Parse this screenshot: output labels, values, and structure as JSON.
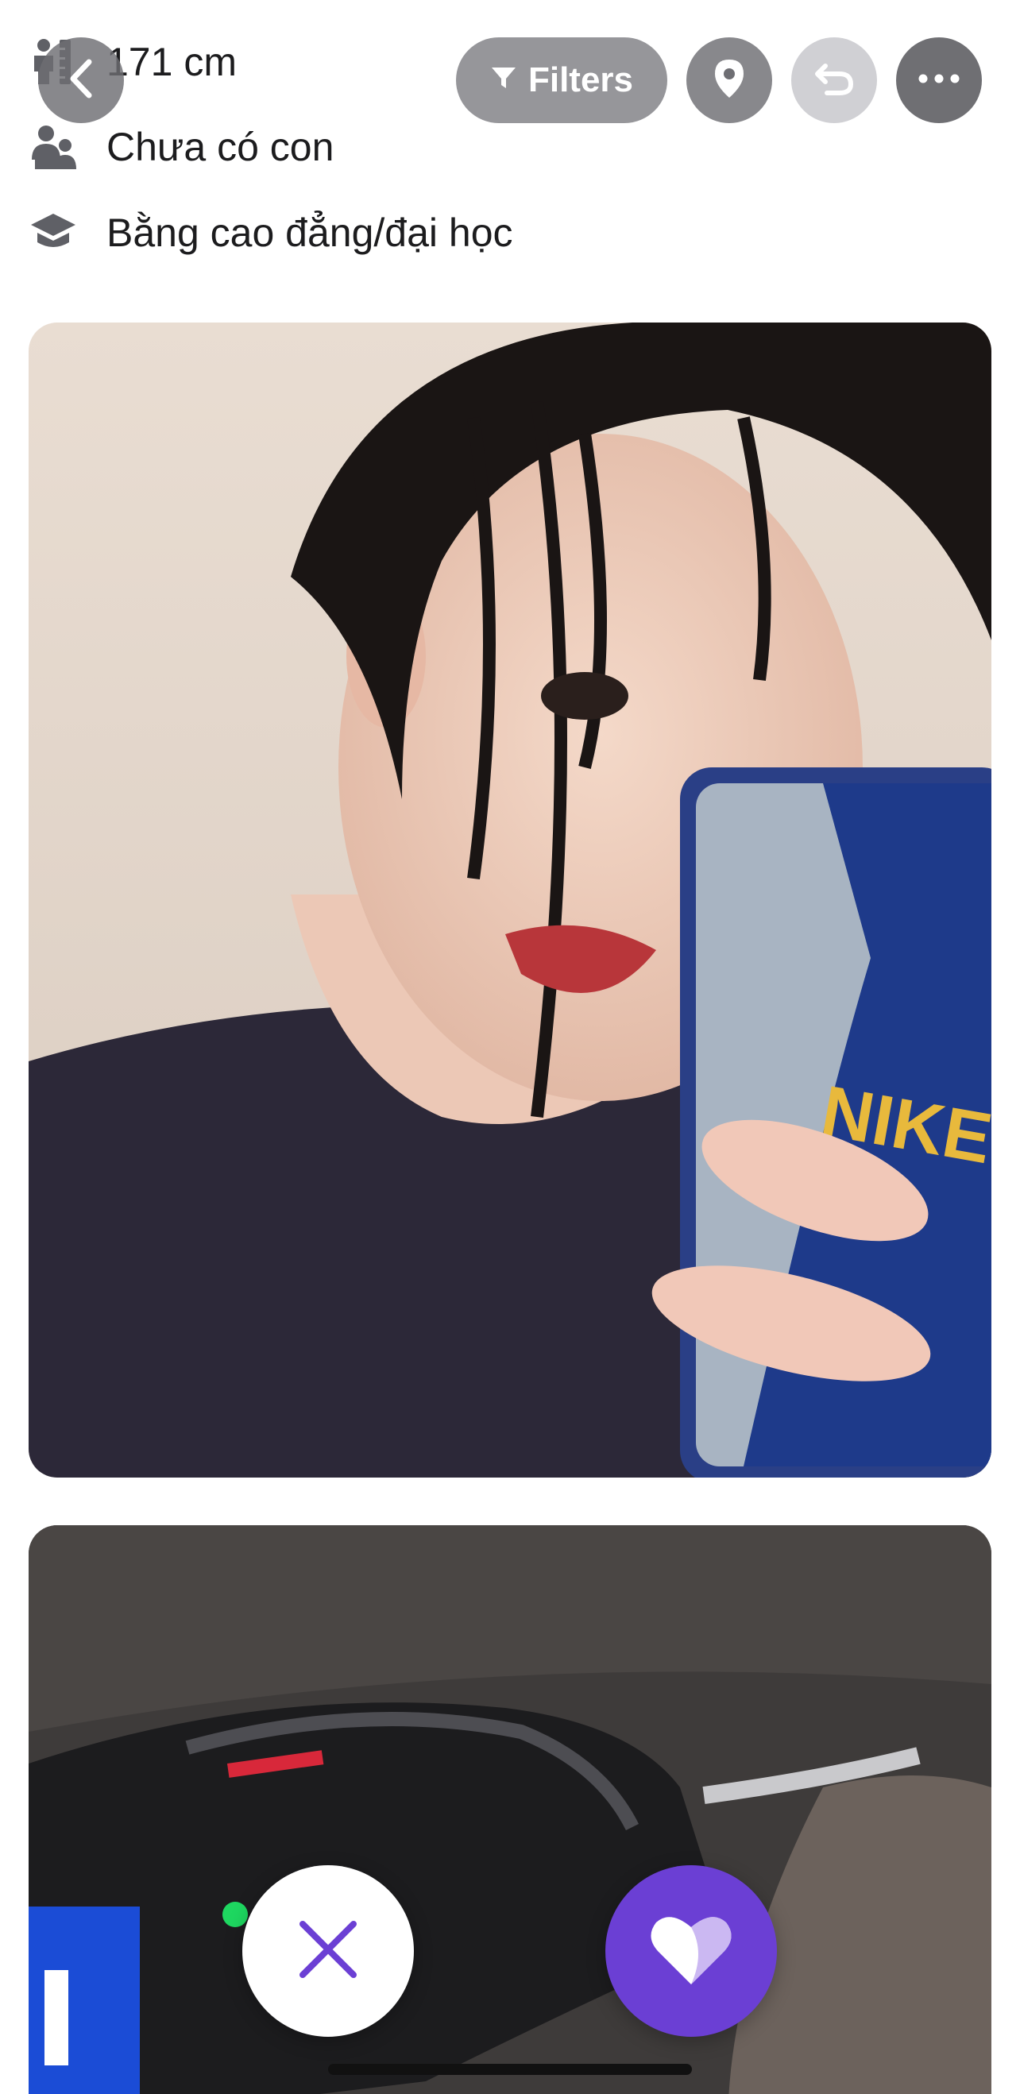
{
  "profile_details": {
    "height": "171 cm",
    "children": "Chưa có con",
    "education": "Bằng cao đẳng/đại học"
  },
  "toolbar": {
    "filters_label": "Filters"
  },
  "icons": {
    "height": "ruler-person-icon",
    "children": "family-icon",
    "education": "graduation-cap-icon",
    "back": "chevron-left-icon",
    "filters": "funnel-icon",
    "location": "map-pin-icon",
    "undo": "undo-icon",
    "more": "more-horizontal-icon",
    "pass": "close-x-icon",
    "like": "heart-icon"
  },
  "colors": {
    "accent": "#6b3fd4",
    "text": "#1c1c1e",
    "icon_gray": "#5f6066"
  }
}
